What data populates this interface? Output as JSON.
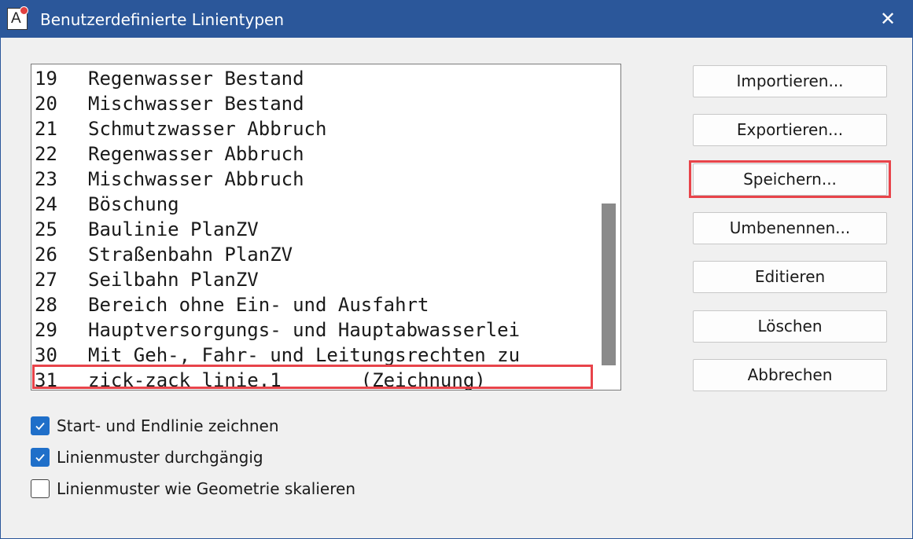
{
  "window": {
    "title": "Benutzerdefinierte Linientypen",
    "icon_letter": "A",
    "close_glyph": "✕"
  },
  "list": {
    "rows": [
      {
        "num": "19",
        "text": "Regenwasser Bestand"
      },
      {
        "num": "20",
        "text": "Mischwasser Bestand"
      },
      {
        "num": "21",
        "text": "Schmutzwasser Abbruch"
      },
      {
        "num": "22",
        "text": "Regenwasser Abbruch"
      },
      {
        "num": "23",
        "text": "Mischwasser Abbruch"
      },
      {
        "num": "24",
        "text": "Böschung"
      },
      {
        "num": "25",
        "text": "Baulinie PlanZV"
      },
      {
        "num": "26",
        "text": "Straßenbahn PlanZV"
      },
      {
        "num": "27",
        "text": "Seilbahn PlanZV"
      },
      {
        "num": "28",
        "text": "Bereich ohne Ein- und Ausfahrt"
      },
      {
        "num": "29",
        "text": "Hauptversorgungs- und Hauptabwasserlei"
      },
      {
        "num": "30",
        "text": "Mit Geh-, Fahr- und Leitungsrechten zu"
      },
      {
        "num": "31",
        "text": "zick-zack linie.1       (Zeichnung)"
      }
    ]
  },
  "buttons": {
    "import": "Importieren...",
    "export": "Exportieren...",
    "save": "Speichern...",
    "rename": "Umbenennen...",
    "edit": "Editieren",
    "delete": "Löschen",
    "cancel": "Abbrechen"
  },
  "options": {
    "start_end": {
      "label": "Start- und Endlinie zeichnen",
      "checked": true
    },
    "continuous": {
      "label": "Linienmuster durchgängig",
      "checked": true
    },
    "scale": {
      "label": "Linienmuster wie Geometrie skalieren",
      "checked": false
    }
  },
  "colors": {
    "titlebar": "#2b579a",
    "highlight": "#e8444a",
    "checkbox_on": "#1f6fc9"
  }
}
